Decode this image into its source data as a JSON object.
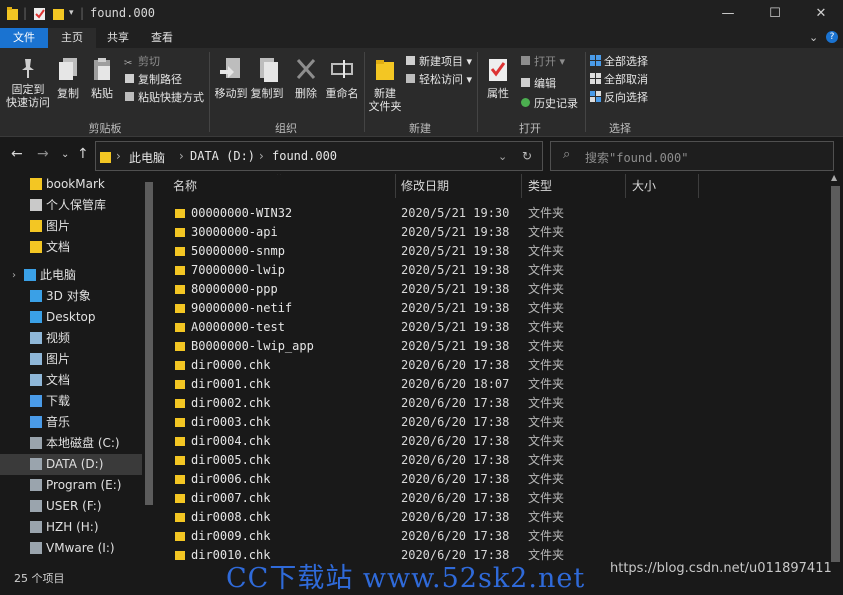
{
  "titlebar": {
    "path_title": "found.000"
  },
  "ribbon_tabs": {
    "file": "文件",
    "home": "主页",
    "share": "共享",
    "view": "查看"
  },
  "ribbon": {
    "clipboard": {
      "pin_label_1": "固定到",
      "pin_label_2": "快速访问",
      "copy": "复制",
      "paste": "粘贴",
      "cut": "剪切",
      "copy_path": "复制路径",
      "paste_shortcut": "粘贴快捷方式",
      "group": "剪贴板"
    },
    "organize": {
      "move_to": "移动到",
      "copy_to": "复制到",
      "delete": "删除",
      "rename": "重命名",
      "group": "组织"
    },
    "new": {
      "new_folder_1": "新建",
      "new_folder_2": "文件夹",
      "new_item": "新建项目",
      "easy_access": "轻松访问",
      "group": "新建"
    },
    "open": {
      "properties": "属性",
      "open": "打开",
      "edit": "编辑",
      "history": "历史记录",
      "group": "打开"
    },
    "select": {
      "select_all": "全部选择",
      "select_none": "全部取消",
      "invert": "反向选择",
      "group": "选择"
    }
  },
  "address": {
    "crumbs": [
      "此电脑",
      "DATA (D:)",
      "found.000"
    ],
    "search_placeholder": "搜索\"found.000\""
  },
  "sidebar": {
    "items": [
      {
        "label": "bookMark",
        "icon": "folder-icon"
      },
      {
        "label": "个人保管库",
        "icon": "vault-icon"
      },
      {
        "label": "图片",
        "icon": "folder-icon"
      },
      {
        "label": "文档",
        "icon": "folder-icon"
      },
      {
        "label": "此电脑",
        "icon": "pc-icon"
      },
      {
        "label": "3D 对象",
        "icon": "3d-objects-icon"
      },
      {
        "label": "Desktop",
        "icon": "desktop-icon"
      },
      {
        "label": "视频",
        "icon": "video-icon"
      },
      {
        "label": "图片",
        "icon": "pictures-icon"
      },
      {
        "label": "文档",
        "icon": "documents-icon"
      },
      {
        "label": "下载",
        "icon": "download-icon"
      },
      {
        "label": "音乐",
        "icon": "music-icon"
      },
      {
        "label": "本地磁盘 (C:)",
        "icon": "drive-icon"
      },
      {
        "label": "DATA (D:)",
        "icon": "drive-icon",
        "selected": true
      },
      {
        "label": "Program (E:)",
        "icon": "drive-icon"
      },
      {
        "label": "USER (F:)",
        "icon": "drive-icon"
      },
      {
        "label": "HZH (H:)",
        "icon": "drive-icon"
      },
      {
        "label": "VMware (I:)",
        "icon": "drive-icon"
      }
    ]
  },
  "columns": {
    "name": "名称",
    "modified": "修改日期",
    "type": "类型",
    "size": "大小"
  },
  "files": [
    {
      "name": "00000000-WIN32",
      "date": "2020/5/21 19:30",
      "type": "文件夹"
    },
    {
      "name": "30000000-api",
      "date": "2020/5/21 19:38",
      "type": "文件夹"
    },
    {
      "name": "50000000-snmp",
      "date": "2020/5/21 19:38",
      "type": "文件夹"
    },
    {
      "name": "70000000-lwip",
      "date": "2020/5/21 19:38",
      "type": "文件夹"
    },
    {
      "name": "80000000-ppp",
      "date": "2020/5/21 19:38",
      "type": "文件夹"
    },
    {
      "name": "90000000-netif",
      "date": "2020/5/21 19:38",
      "type": "文件夹"
    },
    {
      "name": "A0000000-test",
      "date": "2020/5/21 19:38",
      "type": "文件夹"
    },
    {
      "name": "B0000000-lwip_app",
      "date": "2020/5/21 19:38",
      "type": "文件夹"
    },
    {
      "name": "dir0000.chk",
      "date": "2020/6/20 17:38",
      "type": "文件夹"
    },
    {
      "name": "dir0001.chk",
      "date": "2020/6/20 18:07",
      "type": "文件夹"
    },
    {
      "name": "dir0002.chk",
      "date": "2020/6/20 17:38",
      "type": "文件夹"
    },
    {
      "name": "dir0003.chk",
      "date": "2020/6/20 17:38",
      "type": "文件夹"
    },
    {
      "name": "dir0004.chk",
      "date": "2020/6/20 17:38",
      "type": "文件夹"
    },
    {
      "name": "dir0005.chk",
      "date": "2020/6/20 17:38",
      "type": "文件夹"
    },
    {
      "name": "dir0006.chk",
      "date": "2020/6/20 17:38",
      "type": "文件夹"
    },
    {
      "name": "dir0007.chk",
      "date": "2020/6/20 17:38",
      "type": "文件夹"
    },
    {
      "name": "dir0008.chk",
      "date": "2020/6/20 17:38",
      "type": "文件夹"
    },
    {
      "name": "dir0009.chk",
      "date": "2020/6/20 17:38",
      "type": "文件夹"
    },
    {
      "name": "dir0010.chk",
      "date": "2020/6/20 17:38",
      "type": "文件夹"
    }
  ],
  "status": {
    "count": "25 个项目"
  },
  "watermarks": {
    "site": "CC下载站 www.52sk2.net",
    "blog": "https://blog.csdn.net/u011897411"
  },
  "colors": {
    "accent": "#1a73d1",
    "folder": "#f3c623",
    "background": "#191919"
  }
}
